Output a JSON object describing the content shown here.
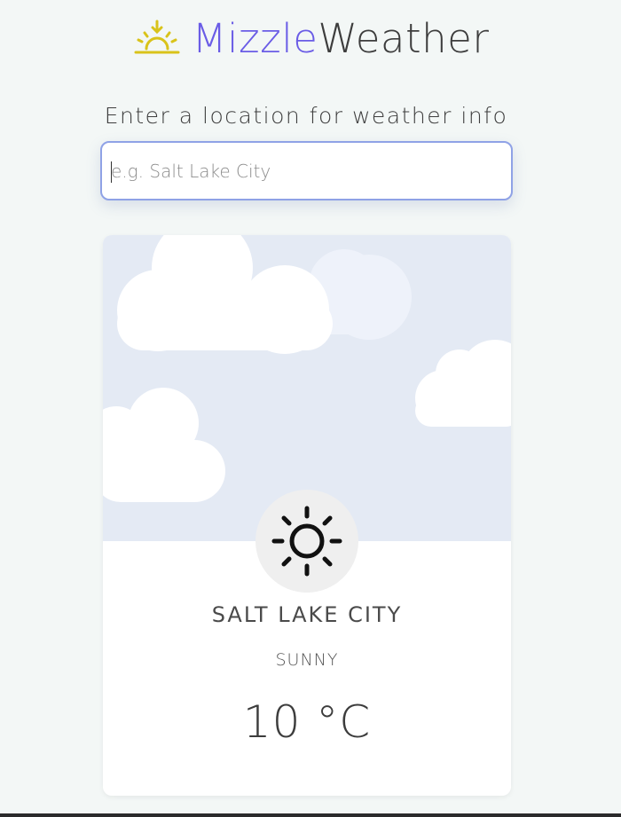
{
  "header": {
    "brand_part1": "Mizzle",
    "brand_part2": "Weather",
    "brand_color": "#6a5ce6",
    "logo_icon": "sunrise-icon",
    "logo_color": "#d9c31a"
  },
  "search": {
    "prompt": "Enter a location for weather info",
    "placeholder": "e.g. Salt Lake City",
    "value": ""
  },
  "weather_card": {
    "city": "SALT LAKE CITY",
    "condition": "SUNNY",
    "temperature": "10 °C",
    "icon": "sun-icon",
    "background": "clouds-illustration"
  }
}
